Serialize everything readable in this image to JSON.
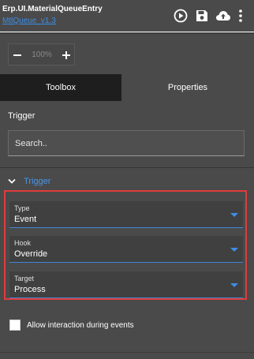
{
  "header": {
    "title": "Erp.UI.MaterialQueueEntry",
    "subtitle": "MtlQueue_v1.3",
    "icons": [
      "play-circle-icon",
      "save-icon",
      "cloud-upload-icon",
      "more-vertical-icon"
    ]
  },
  "zoom": {
    "minus_icon": "minus-icon",
    "value": "100%",
    "plus_icon": "plus-icon"
  },
  "tabs": [
    {
      "label": "Toolbox",
      "active": true
    },
    {
      "label": "Properties",
      "active": false
    }
  ],
  "trigger_section": {
    "title": "Trigger",
    "search_placeholder": "Search.."
  },
  "trigger_group": {
    "label": "Trigger",
    "expanded": true,
    "fields": [
      {
        "label": "Type",
        "value": "Event"
      },
      {
        "label": "Hook",
        "value": "Override"
      },
      {
        "label": "Target",
        "value": "Process"
      }
    ]
  },
  "options": {
    "allow_interaction_label": "Allow interaction during events",
    "allow_interaction_checked": false
  },
  "colors": {
    "background": "#4a4a4a",
    "active_tab": "#1e1e1e",
    "accent": "#3d8ee6",
    "highlight": "#e03c3c"
  }
}
